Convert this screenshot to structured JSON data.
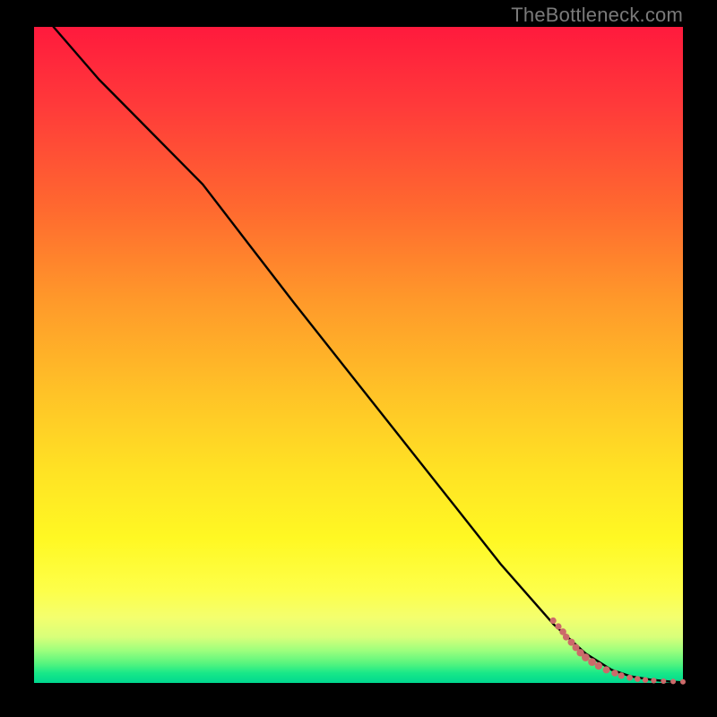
{
  "watermark": "TheBottleneck.com",
  "colors": {
    "point": "#cc6a6a",
    "line": "#000000"
  },
  "chart_data": {
    "type": "line",
    "title": "",
    "xlabel": "",
    "ylabel": "",
    "xlim": [
      0,
      100
    ],
    "ylim": [
      0,
      100
    ],
    "grid": false,
    "legend": false,
    "series": [
      {
        "name": "curve",
        "kind": "line",
        "x": [
          3,
          10,
          18,
          26,
          33,
          40,
          48,
          56,
          64,
          72,
          80,
          85,
          89,
          92,
          95,
          98,
          100
        ],
        "y": [
          100,
          92,
          84,
          76,
          67,
          58,
          48,
          38,
          28,
          18,
          9,
          4.5,
          2,
          1,
          0.5,
          0.2,
          0.1
        ]
      },
      {
        "name": "points",
        "kind": "scatter",
        "x": [
          80.0,
          80.8,
          81.5,
          82.0,
          82.8,
          83.5,
          84.2,
          85.0,
          86.0,
          87.0,
          88.2,
          89.5,
          90.5,
          91.8,
          93.0,
          94.2,
          95.5,
          97.0,
          98.5,
          100.0
        ],
        "y": [
          9.5,
          8.6,
          7.8,
          7.0,
          6.2,
          5.4,
          4.6,
          3.9,
          3.2,
          2.6,
          2.0,
          1.5,
          1.1,
          0.8,
          0.6,
          0.45,
          0.35,
          0.28,
          0.22,
          0.18
        ],
        "r": [
          3.6,
          3.6,
          3.8,
          3.8,
          4.0,
          4.0,
          4.2,
          4.4,
          4.4,
          4.2,
          4.0,
          3.8,
          3.6,
          3.4,
          3.3,
          3.2,
          3.1,
          3.0,
          3.0,
          3.0
        ]
      }
    ]
  }
}
